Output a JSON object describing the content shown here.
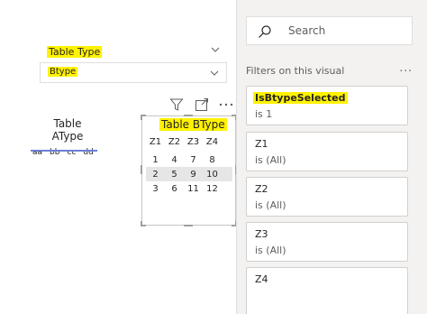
{
  "slicer": {
    "title": "Table Type",
    "selected_value": "Btype"
  },
  "table_a": {
    "title": "Table AType",
    "items": [
      "aa",
      "bb",
      "cc",
      "dd"
    ]
  },
  "table_b": {
    "title": "Table BType",
    "headers": [
      "Z1",
      "Z2",
      "Z3",
      "Z4"
    ],
    "rows": [
      [
        "1",
        "4",
        "7",
        "8"
      ],
      [
        "2",
        "5",
        "9",
        "10"
      ],
      [
        "3",
        "6",
        "11",
        "12"
      ]
    ]
  },
  "visual_icons": [
    "filter-icon",
    "focus-mode-icon",
    "more-options-icon"
  ],
  "filters_pane": {
    "search_placeholder": "Search",
    "title": "Filters on this visual",
    "more": "...",
    "cards": [
      {
        "name": "IsBtypeSelected",
        "condition": "is 1"
      },
      {
        "name": "Z1",
        "condition": "is (All)"
      },
      {
        "name": "Z2",
        "condition": "is (All)"
      },
      {
        "name": "Z3",
        "condition": "is (All)"
      },
      {
        "name": "Z4",
        "condition": ""
      }
    ]
  },
  "colors": {
    "highlight": "#fff200",
    "pane_bg": "#f3f2f1",
    "accent_underline": "#6a7ed8"
  }
}
